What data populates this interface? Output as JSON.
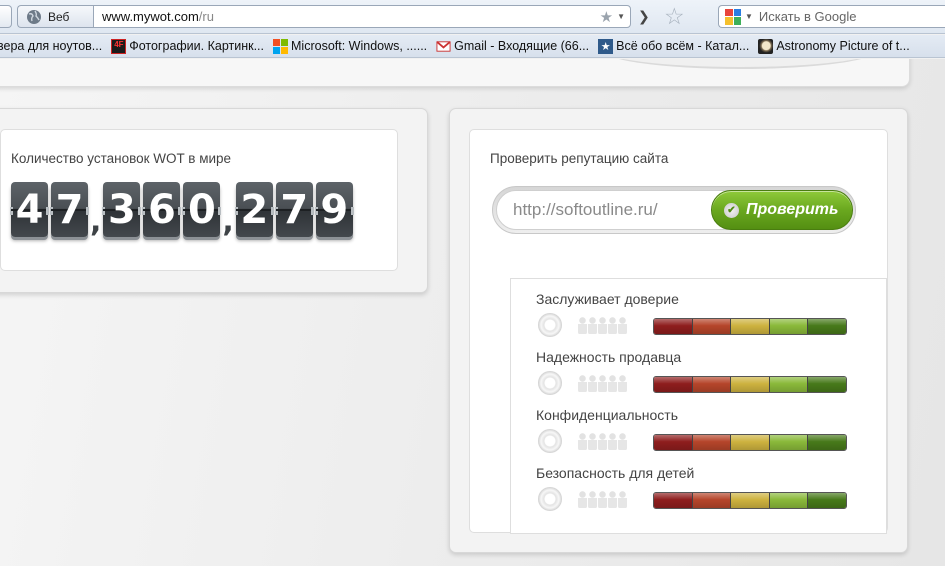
{
  "browser": {
    "identity_label": "Веб",
    "url_host": "www.mywot.com",
    "url_path": "/ru",
    "search_placeholder": "Искать в Google"
  },
  "bookmarks": [
    {
      "label": "вера для ноутов...",
      "icon": "page-icon"
    },
    {
      "label": "Фотографии. Картинк...",
      "icon": "photo-site-icon"
    },
    {
      "label": "Microsoft: Windows, ......",
      "icon": "microsoft-logo-icon"
    },
    {
      "label": "Gmail - Входящие (66...",
      "icon": "gmail-icon"
    },
    {
      "label": "Всё обо всём - Катал...",
      "icon": "star-badge-icon"
    },
    {
      "label": "Astronomy Picture of t...",
      "icon": "astronomy-icon"
    }
  ],
  "counter": {
    "label": "Количество установок WOT в мире",
    "value": "47,360,279"
  },
  "checker": {
    "label": "Проверить репутацию сайта",
    "input_value": "http://softoutline.ru/",
    "button_label": "Проверить"
  },
  "ratings": [
    {
      "label": "Заслуживает доверие"
    },
    {
      "label": "Надежность продавца"
    },
    {
      "label": "Конфиденциальность"
    },
    {
      "label": "Безопасность для детей"
    }
  ],
  "colors": {
    "rating_scale": [
      "#8e1d1d",
      "#b5452a",
      "#cdb23f",
      "#8ab93a",
      "#47791a"
    ],
    "check_button": "#6aa81f",
    "counter_tile": "#4a4f54"
  }
}
